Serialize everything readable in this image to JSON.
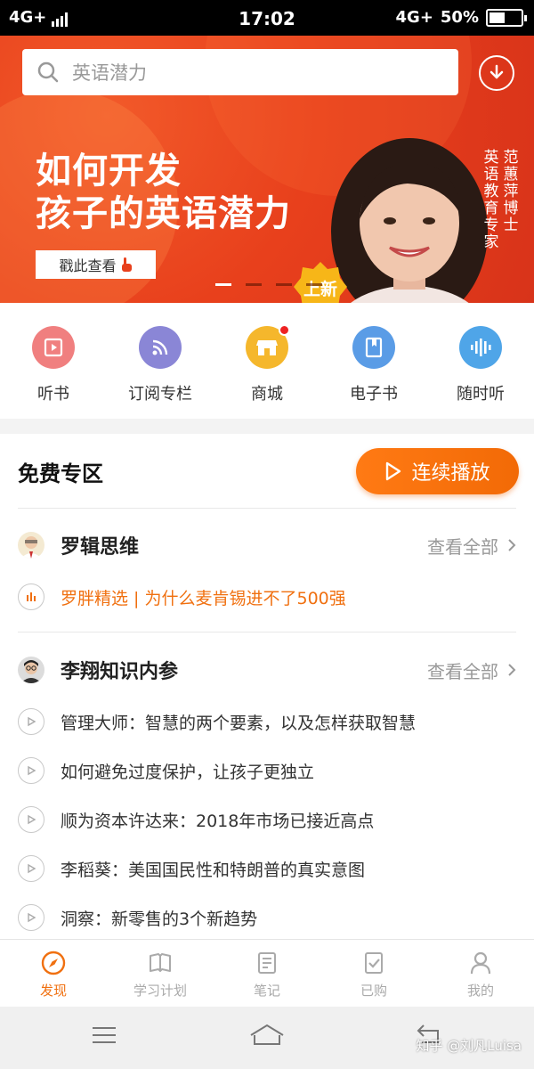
{
  "status_bar": {
    "network_left": "4G+",
    "time": "17:02",
    "network_right": "4G+",
    "battery": "50%",
    "battery_level": 0.5
  },
  "search": {
    "placeholder": "英语潜力"
  },
  "banner": {
    "headline_line1": "如何开发",
    "headline_line2": "孩子的英语潜力",
    "cta_label": "戳此查看",
    "badge": "上新",
    "caption_col1": "范蕙萍博士",
    "caption_col2": "英语教育专家",
    "slide_count": 4,
    "active_slide": 0
  },
  "quick_nav": [
    {
      "label": "听书",
      "icon": "book-play-icon",
      "color": "#f07f7f"
    },
    {
      "label": "订阅专栏",
      "icon": "rss-icon",
      "color": "#8a86d6"
    },
    {
      "label": "商城",
      "icon": "store-icon",
      "color": "#f5b72c",
      "badge_dot": true
    },
    {
      "label": "电子书",
      "icon": "ebook-icon",
      "color": "#5a9ce6"
    },
    {
      "label": "随时听",
      "icon": "audio-wave-icon",
      "color": "#4fa5e8"
    }
  ],
  "free_zone": {
    "title": "免费专区",
    "play_all_label": "连续播放",
    "groups": [
      {
        "name": "罗辑思维",
        "view_all": "查看全部",
        "tracks": [
          {
            "title": "罗胖精选 | 为什么麦肯锡进不了500强",
            "playing": true
          }
        ]
      },
      {
        "name": "李翔知识内参",
        "view_all": "查看全部",
        "tracks": [
          {
            "title": "管理大师：智慧的两个要素，以及怎样获取智慧"
          },
          {
            "title": "如何避免过度保护，让孩子更独立"
          },
          {
            "title": "顺为资本许达来：2018年市场已接近高点"
          },
          {
            "title": "李稻葵：美国国民性和特朗普的真实意图"
          },
          {
            "title": "洞察：新零售的3个新趋势"
          }
        ]
      }
    ]
  },
  "tab_bar": [
    {
      "label": "发现",
      "icon": "compass-icon",
      "active": true
    },
    {
      "label": "学习计划",
      "icon": "open-book-icon"
    },
    {
      "label": "笔记",
      "icon": "notes-icon"
    },
    {
      "label": "已购",
      "icon": "purchased-icon"
    },
    {
      "label": "我的",
      "icon": "person-icon"
    }
  ],
  "watermark": "知乎 @刘凡Luisa",
  "colors": {
    "accent": "#f07010",
    "banner": "#e8401c"
  }
}
